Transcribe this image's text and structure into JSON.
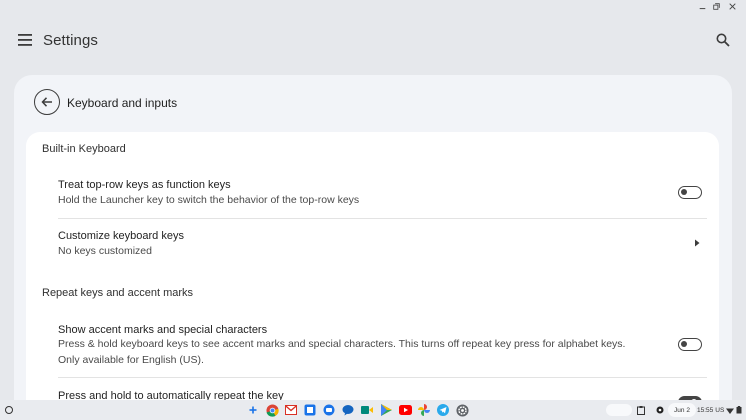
{
  "app": {
    "title": "Settings"
  },
  "page": {
    "title": "Keyboard and inputs"
  },
  "sections": [
    {
      "title": "Built-in Keyboard",
      "rows": [
        {
          "title": "Treat top-row keys as function keys",
          "subtitle": "Hold the Launcher key to switch the behavior of the top-row keys",
          "control": "toggle",
          "state": "off"
        },
        {
          "title": "Customize keyboard keys",
          "subtitle": "No keys customized",
          "control": "chevron"
        }
      ]
    },
    {
      "title": "Repeat keys and accent marks",
      "rows": [
        {
          "title": "Show accent marks and special characters",
          "subtitle": "Press & hold keyboard keys to see accent marks and special characters. This turns off repeat key press for alphabet keys. Only available for English (US).",
          "control": "toggle",
          "state": "off"
        },
        {
          "title": "Press and hold to automatically repeat the key",
          "control": "toggle",
          "state": "on"
        }
      ]
    }
  ],
  "shelf": {
    "apps": [
      "add-icon",
      "chrome-icon",
      "gmail-icon",
      "files-icon",
      "drive-icon",
      "messages-icon",
      "meet-icon",
      "play-store-icon",
      "youtube-icon",
      "photos-icon",
      "telegram-icon",
      "settings-icon"
    ],
    "date": "Jun 2",
    "time": "15:55",
    "region": "US"
  },
  "colors": {
    "background": "#e6e8ec",
    "panel": "#f2f4f8",
    "card": "#ffffff",
    "text": "#1f1f1f",
    "secondary_text": "#4a4a4a"
  }
}
